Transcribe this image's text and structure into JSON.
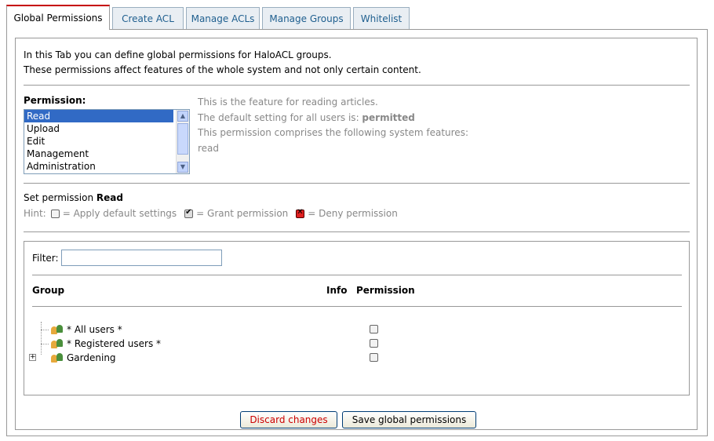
{
  "tabs": [
    "Global Permissions",
    "Create ACL",
    "Manage ACLs",
    "Manage Groups",
    "Whitelist"
  ],
  "intro": {
    "line1": "In this Tab you can define global permissions for HaloACL groups.",
    "line2": "These permissions affect features of the whole system and not only certain content."
  },
  "permission": {
    "label": "Permission:",
    "items": [
      "Read",
      "Upload",
      "Edit",
      "Management",
      "Administration"
    ],
    "selected": "Read"
  },
  "description": {
    "line1": "This is the feature for reading articles.",
    "line2_prefix": "The default setting for all users is: ",
    "line2_value": "permitted",
    "line3": "This permission comprises the following system features:",
    "line4": "read"
  },
  "set_permission": {
    "prefix": "Set permission ",
    "name": "Read"
  },
  "hint": {
    "label": "Hint:",
    "default": "= Apply default settings",
    "grant": "= Grant permission",
    "deny": "= Deny permission"
  },
  "filter": {
    "label": "Filter:",
    "value": ""
  },
  "columns": {
    "group": "Group",
    "info": "Info",
    "permission": "Permission"
  },
  "groups": [
    "* All users *",
    "* Registered users *",
    "Gardening"
  ],
  "buttons": {
    "discard": "Discard changes",
    "save": "Save global permissions"
  },
  "colors": {
    "accent": "#c60000",
    "selection": "#316ac5",
    "link": "#1f5f8f",
    "discard_text": "#cc0000"
  },
  "icons": [
    "group-icon",
    "expand-plus-icon",
    "scroll-up-icon",
    "scroll-down-icon",
    "checkbox-default-icon",
    "checkbox-grant-icon",
    "checkbox-deny-icon"
  ]
}
